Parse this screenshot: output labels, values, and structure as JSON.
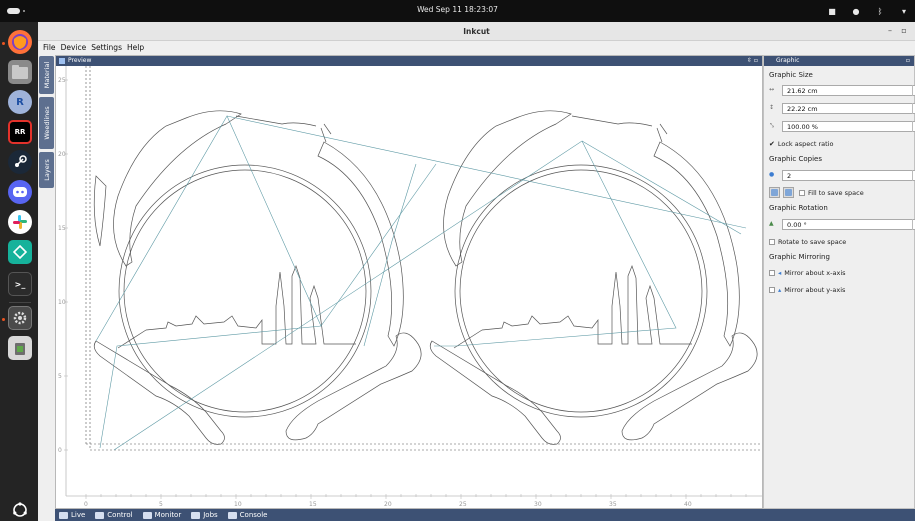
{
  "system": {
    "clock": "Wed Sep 11  18:23:07"
  },
  "dock": [
    {
      "name": "firefox-icon",
      "color": "#e66000"
    },
    {
      "name": "files-icon",
      "color": "#777777"
    },
    {
      "name": "r-icon",
      "label": "R",
      "color": "#5a7fd4"
    },
    {
      "name": "rustrover-icon",
      "label": "RR",
      "color": "#d02b2b"
    },
    {
      "name": "steam-icon",
      "color": "#1b2838"
    },
    {
      "name": "discord-icon",
      "color": "#5865f2"
    },
    {
      "name": "slack-icon",
      "color": "#ffffff"
    },
    {
      "name": "sync-icon",
      "color": "#16b29b"
    },
    {
      "name": "terminal-icon",
      "color": "#333333"
    },
    {
      "name": "settings-icon",
      "color": "#6e6e6e"
    },
    {
      "name": "trash-icon",
      "color": "#5ea84a"
    },
    {
      "name": "ubuntu-icon",
      "color": "#242424"
    }
  ],
  "window": {
    "title": "Inkcut"
  },
  "menu": [
    "File",
    "Device",
    "Settings",
    "Help"
  ],
  "side_tabs": [
    "Material",
    "Weedlines",
    "Layers"
  ],
  "preview": {
    "title": "Preview",
    "y_ticks": [
      "25",
      "20",
      "15",
      "10",
      "5",
      "0"
    ],
    "x_ticks": [
      "0",
      "5",
      "10",
      "15",
      "20",
      "25",
      "30",
      "35",
      "40"
    ]
  },
  "graphic": {
    "title": "Graphic",
    "size_heading": "Graphic Size",
    "width": "21.62 cm",
    "height": "22.22 cm",
    "scale": "100.00 %",
    "lock_aspect_label": "Lock aspect ratio",
    "lock_aspect_checked": true,
    "copies_heading": "Graphic Copies",
    "copies": "2",
    "fill_label": "Fill to save space",
    "rotation_heading": "Graphic Rotation",
    "rotation": "0.00 °",
    "rotate_save_label": "Rotate to save space",
    "mirroring_heading": "Graphic Mirroring",
    "mirror_x_label": "Mirror about x-axis",
    "mirror_y_label": "Mirror about y-axis"
  },
  "bottom_tabs": [
    "Live",
    "Control",
    "Monitor",
    "Jobs",
    "Console"
  ]
}
